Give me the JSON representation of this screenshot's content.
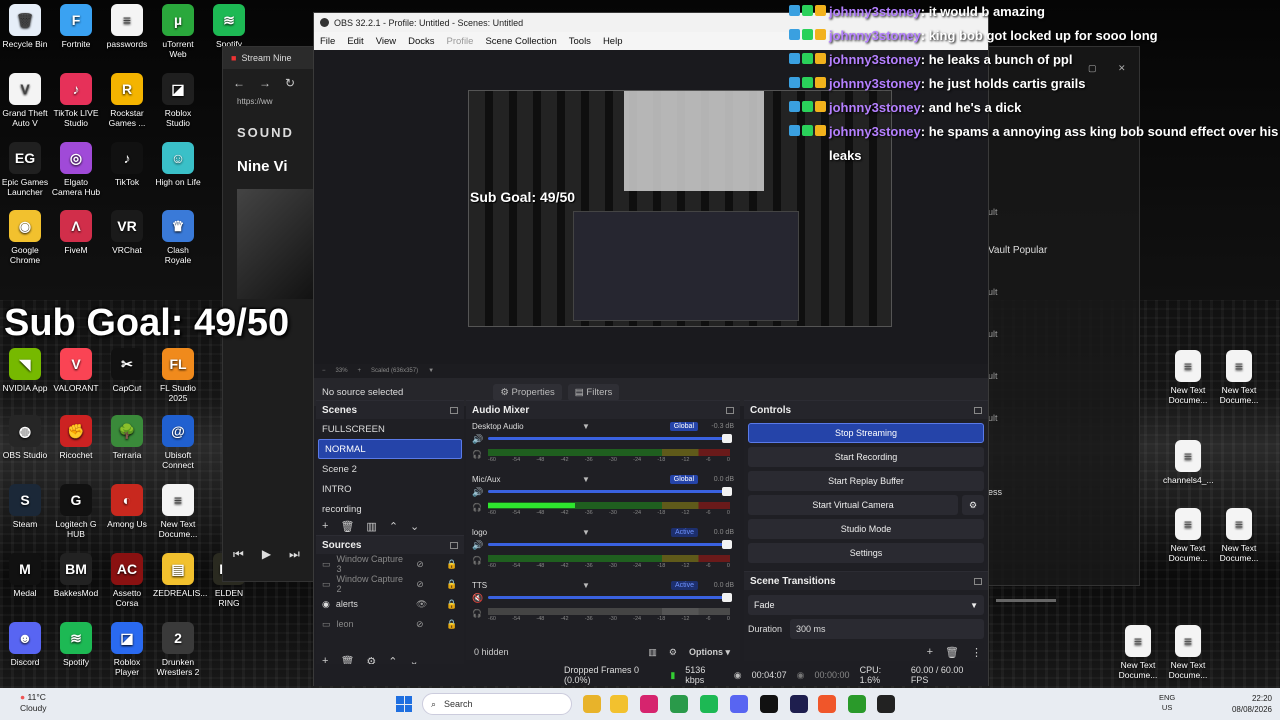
{
  "desktop": {
    "icons": [
      {
        "label": "Recycle Bin",
        "color": "#e6eef8",
        "glyph": "🗑"
      },
      {
        "label": "Fortnite",
        "color": "#3aa2f2",
        "glyph": "F"
      },
      {
        "label": "passwords",
        "color": "#f4f4f4",
        "glyph": "≡"
      },
      {
        "label": "uTorrent Web",
        "color": "#2aa83c",
        "glyph": "µ"
      },
      {
        "label": "Spotify",
        "color": "#1db954",
        "glyph": "≋"
      },
      {
        "label": "Grand Theft Auto V",
        "color": "#f4f4f4",
        "glyph": "V"
      },
      {
        "label": "TikTok LIVE Studio",
        "color": "#e63159",
        "glyph": "♪"
      },
      {
        "label": "Rockstar Games ...",
        "color": "#f4b400",
        "glyph": "R"
      },
      {
        "label": "Roblox Studio",
        "color": "#1f1f1f",
        "glyph": "◪"
      },
      {
        "label": "Epic Games Launcher",
        "color": "#202020",
        "glyph": "EG"
      },
      {
        "label": "Elgato Camera Hub",
        "color": "#a04ad8",
        "glyph": "◎"
      },
      {
        "label": "TikTok",
        "color": "#111111",
        "glyph": "♪"
      },
      {
        "label": "High on Life",
        "color": "#3ac0c8",
        "glyph": "☺"
      },
      {
        "label": "Google Chrome",
        "color": "#f2c12e",
        "glyph": "◉"
      },
      {
        "label": "FiveM",
        "color": "#d12e4a",
        "glyph": "Λ"
      },
      {
        "label": "VRChat",
        "color": "#1a1a1a",
        "glyph": "VR"
      },
      {
        "label": "Clash Royale",
        "color": "#3a7ad8",
        "glyph": "♛"
      },
      {
        "label": "NVIDIA App",
        "color": "#76b900",
        "glyph": "◥"
      },
      {
        "label": "VALORANT",
        "color": "#fa4454",
        "glyph": "V"
      },
      {
        "label": "CapCut",
        "color": "#111111",
        "glyph": "✂"
      },
      {
        "label": "FL Studio 2025",
        "color": "#f08a1c",
        "glyph": "FL"
      },
      {
        "label": "OBS Studio",
        "color": "#262626",
        "glyph": "◍"
      },
      {
        "label": "Ricochet",
        "color": "#cc2222",
        "glyph": "✊"
      },
      {
        "label": "Terraria",
        "color": "#3a8a3a",
        "glyph": "🌳"
      },
      {
        "label": "Ubisoft Connect",
        "color": "#2060d0",
        "glyph": "@"
      },
      {
        "label": "Steam",
        "color": "#1b2838",
        "glyph": "S"
      },
      {
        "label": "Logitech G HUB",
        "color": "#111111",
        "glyph": "G"
      },
      {
        "label": "Among Us",
        "color": "#c8281e",
        "glyph": "◐"
      },
      {
        "label": "New Text Docume...",
        "color": "#f4f4f4",
        "glyph": "≡"
      },
      {
        "label": "Medal",
        "color": "#111111",
        "glyph": "M"
      },
      {
        "label": "BakkesMod",
        "color": "#222222",
        "glyph": "BM"
      },
      {
        "label": "Assetto Corsa",
        "color": "#8a1111",
        "glyph": "AC"
      },
      {
        "label": "ZEDREALIS...",
        "color": "#f2c12e",
        "glyph": "▤"
      },
      {
        "label": "ELDEN RING",
        "color": "#2a2a20",
        "glyph": "ER"
      },
      {
        "label": "Discord",
        "color": "#5865f2",
        "glyph": "☻"
      },
      {
        "label": "Spotify",
        "color": "#1db954",
        "glyph": "≋"
      },
      {
        "label": "Roblox Player",
        "color": "#2a6af0",
        "glyph": "◪"
      },
      {
        "label": "Drunken Wrestlers 2",
        "color": "#3a3a3a",
        "glyph": "2"
      }
    ],
    "right_icons": [
      {
        "label": "New Text Docume..."
      },
      {
        "label": "New Text Docume..."
      },
      {
        "label": "channels4_..."
      },
      {
        "label": "New Text Docume..."
      },
      {
        "label": "New Text Docume..."
      },
      {
        "label": "New Text Docume..."
      },
      {
        "label": "New Text Docume..."
      }
    ],
    "sub_goal": "Sub Goal: 49/50"
  },
  "browser": {
    "tab_title": "Stream Nine",
    "url": "https://ww",
    "site": "SOUND",
    "heading": "Nine Vi"
  },
  "obs": {
    "title": "OBS 32.2.1 - Profile: Untitled - Scenes: Untitled",
    "menu": [
      "File",
      "Edit",
      "View",
      "Docks",
      "Profile",
      "Scene Collection",
      "Tools",
      "Help"
    ],
    "preview_overlay": "Sub Goal: 49/50",
    "zoom": "33%",
    "scaled": "Scaled (636x357)",
    "no_source": "No source selected",
    "properties_label": "Properties",
    "filters_label": "Filters",
    "scenes_title": "Scenes",
    "scenes": [
      {
        "name": "FULLSCREEN",
        "selected": false
      },
      {
        "name": "NORMAL",
        "selected": true
      },
      {
        "name": "Scene 2",
        "selected": false
      },
      {
        "name": "INTRO",
        "selected": false
      },
      {
        "name": "recording",
        "selected": false
      }
    ],
    "sources_title": "Sources",
    "sources": [
      {
        "name": "Window Capture 3",
        "active": false
      },
      {
        "name": "Window Capture 2",
        "active": false
      },
      {
        "name": "alerts",
        "active": true
      },
      {
        "name": "leon",
        "active": false
      }
    ],
    "mixer_title": "Audio Mixer",
    "mixer": [
      {
        "name": "Desktop Audio",
        "tag": "Global",
        "db": "-0.3 dB",
        "level": 0.0
      },
      {
        "name": "Mic/Aux",
        "tag": "Global",
        "db": "0.0 dB",
        "level": 0.36
      },
      {
        "name": "logo",
        "tag": "Active",
        "db": "0.0 dB",
        "level": 0.0
      },
      {
        "name": "TTS",
        "tag": "Active",
        "db": "0.0 dB",
        "level": 0.0
      }
    ],
    "meter_scale": [
      "-60",
      "-54",
      "-48",
      "-42",
      "-36",
      "-30",
      "-24",
      "-18",
      "-12",
      "-6",
      "0"
    ],
    "hidden_label": "0 hidden",
    "options_label": "Options",
    "controls_title": "Controls",
    "controls": {
      "stop_streaming": "Stop Streaming",
      "start_recording": "Start Recording",
      "start_replay": "Start Replay Buffer",
      "start_virtual": "Start Virtual Camera",
      "studio_mode": "Studio Mode",
      "settings": "Settings"
    },
    "transitions_title": "Scene Transitions",
    "transition": "Fade",
    "duration_label": "Duration",
    "duration_value": "300 ms",
    "status": {
      "dropped": "Dropped Frames 0 (0.0%)",
      "bitrate": "5136 kbps",
      "stream_time": "00:04:07",
      "rec_time": "00:00:00",
      "cpu": "CPU: 1.6%",
      "fps": "60.00 / 60.00 FPS"
    }
  },
  "chat": {
    "messages": [
      {
        "user": "johnny3stoney",
        "msg": "it would b amazing"
      },
      {
        "user": "johnny3stoney",
        "msg": "king bob got locked up for sooo long"
      },
      {
        "user": "johnny3stoney",
        "msg": "he leaks a bunch of ppl"
      },
      {
        "user": "johnny3stoney",
        "msg": "he just holds cartis grails"
      },
      {
        "user": "johnny3stoney",
        "msg": "and he's a dick"
      },
      {
        "user": "johnny3stoney",
        "msg": "he spams a annoying ass king bob sound effect over his leaks"
      }
    ]
  },
  "right_window": {
    "vault_popular": "Vault Popular",
    "ult": "ult",
    "ess": "ess"
  },
  "taskbar": {
    "temp": "11°C",
    "weather": "Cloudy",
    "search": "Search",
    "lang_top": "ENG",
    "lang_bottom": "US",
    "time": "22:20",
    "date": "08/08/2026"
  }
}
